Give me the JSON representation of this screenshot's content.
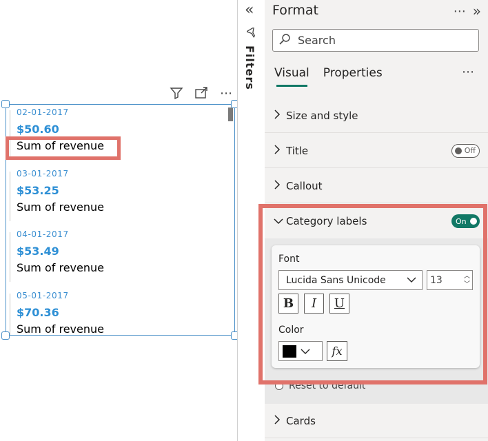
{
  "canvas": {
    "cards": [
      {
        "date": "02-01-2017",
        "value": "$50.60",
        "label": "Sum of revenue"
      },
      {
        "date": "03-01-2017",
        "value": "$53.25",
        "label": "Sum of revenue"
      },
      {
        "date": "04-01-2017",
        "value": "$53.49",
        "label": "Sum of revenue"
      },
      {
        "date": "05-01-2017",
        "value": "$70.36",
        "label": "Sum of revenue"
      }
    ]
  },
  "filters": {
    "label": "Filters"
  },
  "format_pane": {
    "title": "Format",
    "search_placeholder": "Search",
    "tabs": [
      {
        "label": "Visual",
        "active": true
      },
      {
        "label": "Properties",
        "active": false
      }
    ],
    "sections": {
      "size_and_style": "Size and style",
      "title": "Title",
      "title_toggle": "Off",
      "callout": "Callout",
      "category_labels": "Category labels",
      "category_toggle": "On",
      "cards": "Cards"
    },
    "category_labels_body": {
      "font_label": "Font",
      "font_family": "Lucida Sans Unicode",
      "font_size": "13",
      "bold": "B",
      "italic": "I",
      "underline": "U",
      "color_label": "Color",
      "color_value": "#000000",
      "fx_label": "fx",
      "reset_label": "Reset to default"
    }
  },
  "colors": {
    "accent": "#117865",
    "highlight": "#e0726a",
    "value_blue": "#2d8fd5"
  }
}
